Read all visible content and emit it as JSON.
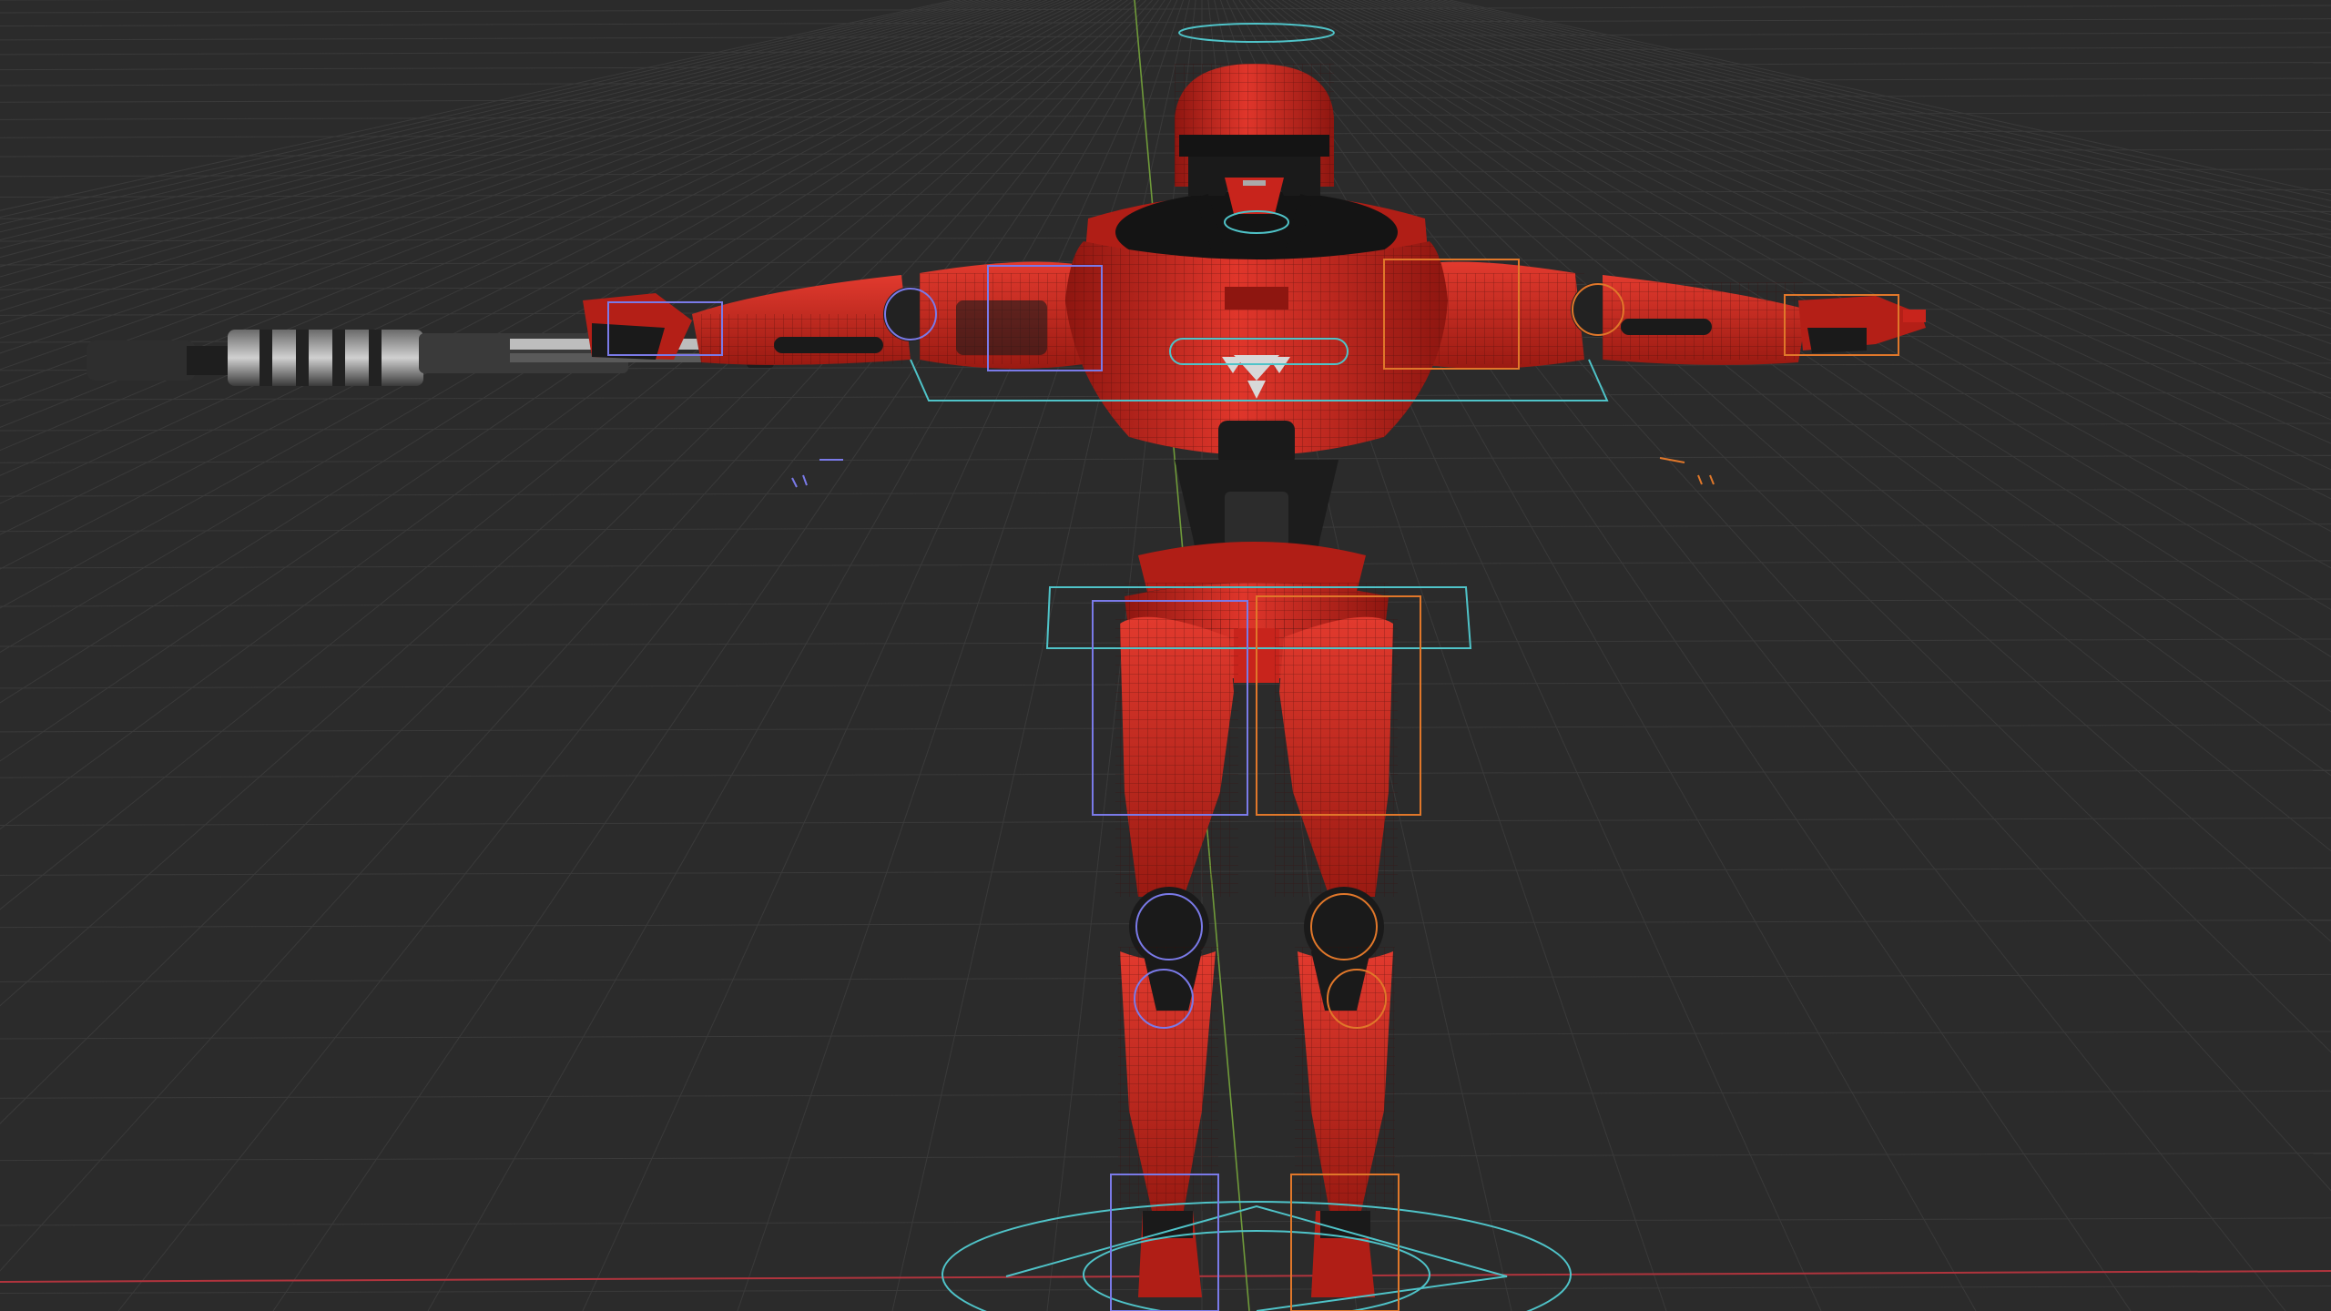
{
  "viewport": {
    "background": "#2b2b2b",
    "grid_color": "#3a3a3a",
    "x_axis_color": "#b0343d",
    "y_axis_color": "#6f9a3a"
  },
  "scene": {
    "robot": {
      "armor_color": "#c8241c",
      "armor_shade": "#8e1610",
      "joint_color": "#1c1c1c",
      "wire_color": "#3a0a08"
    },
    "rifle": {
      "body_color": "#2e2e2e",
      "metal_color": "#8a8a8a"
    },
    "rig": {
      "left_controls_color": "#7a7ae8",
      "right_controls_color": "#e0772a",
      "center_controls_color": "#4fc3c8"
    },
    "emblem_icon": "triangle-emblem-icon"
  }
}
